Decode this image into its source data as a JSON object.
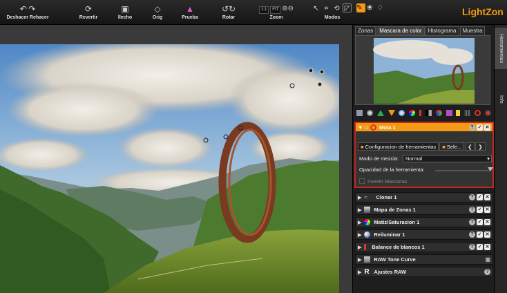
{
  "app": {
    "brand": "LightZon"
  },
  "toolbar": {
    "undo_redo_label": "Deshacer Rehacer",
    "revert_label": "Revertir",
    "done_label": "llecho",
    "orig_label": "Orig",
    "proof_label": "Prueba",
    "rotate_label": "Rotar",
    "zoom_label": "Zoom",
    "zoom_1to1": "1:1",
    "zoom_fit": "FIT",
    "modes_label": "Modos"
  },
  "side_tabs": {
    "tools": "Herramientas",
    "info": "Info"
  },
  "panel_tabs": [
    "Zonas",
    "Mascara de color",
    "Histograma",
    "Muestra"
  ],
  "active_tool": {
    "title": "Mota 1",
    "tab_config": "Configuracion de herramientas",
    "tab_select": "Sele...",
    "blend_label": "Modo de mezcla:",
    "blend_value": "Normal",
    "opacity_label": "Opacidad de la herramienta:",
    "opacity": 1.0,
    "invert_mask_label": "Invertir Mascaras"
  },
  "tools": [
    {
      "label": "Clonar 1",
      "icon": "clone-icon"
    },
    {
      "label": "Mapa de Zonas 1",
      "icon": "zone-map-icon"
    },
    {
      "label": "Matiz/Saturacion 1",
      "icon": "hue-saturation-icon"
    },
    {
      "label": "Reiluminar 1",
      "icon": "relight-icon"
    },
    {
      "label": "Balance de blancos 1",
      "icon": "white-balance-icon"
    },
    {
      "label": "RAW Tone Curve",
      "icon": "raw-tone-curve-icon"
    },
    {
      "label": "Ajustes RAW",
      "icon": "raw-adjust-icon"
    }
  ],
  "colors": {
    "accent": "#f39a14",
    "highlight_border": "#c0271f"
  }
}
